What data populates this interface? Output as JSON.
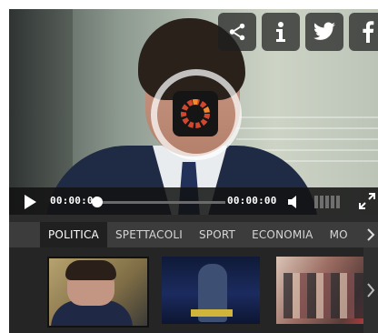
{
  "player": {
    "current_time": "00:00:00",
    "duration": "00:00:00",
    "seek_progress": 0,
    "loading": true
  },
  "share_icons": [
    "share-icon",
    "info-icon",
    "twitter-icon",
    "facebook-icon"
  ],
  "tabs": [
    {
      "label": "POLITICA",
      "active": true
    },
    {
      "label": "SPETTACOLI",
      "active": false
    },
    {
      "label": "SPORT",
      "active": false
    },
    {
      "label": "ECONOMIA",
      "active": false
    },
    {
      "label": "MO",
      "active": false
    }
  ],
  "thumbnails": [
    {
      "selected": true
    },
    {
      "selected": false
    },
    {
      "selected": false
    }
  ],
  "colors": {
    "control_bar": "#121212",
    "tabs_bg": "#3c3c3c",
    "active_tab": "#202020",
    "spinner_accent": "#d2462e"
  }
}
